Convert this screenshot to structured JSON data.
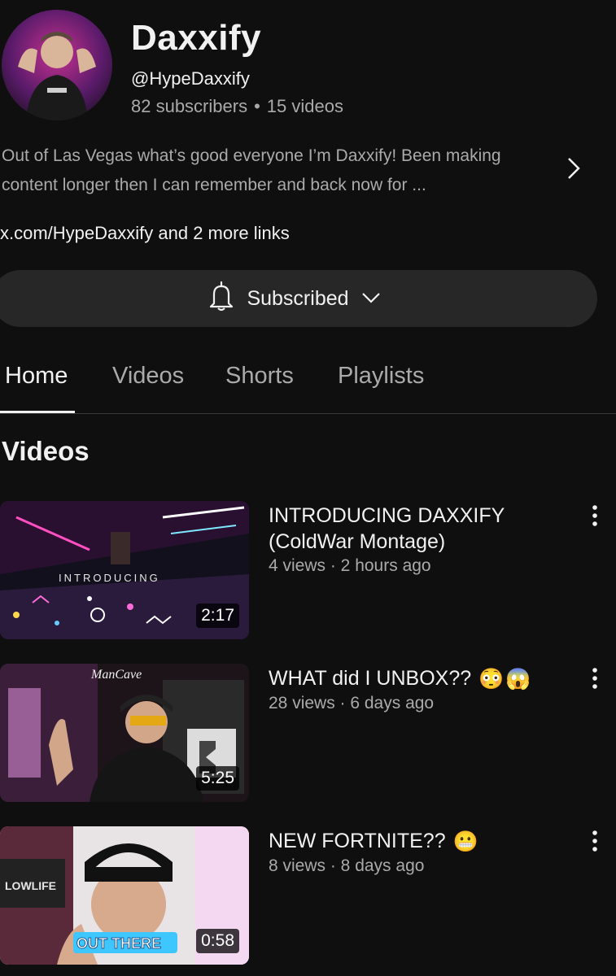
{
  "channel": {
    "name": "Daxxify",
    "handle": "@HypeDaxxify",
    "subscribers": "82 subscribers",
    "videos_count": "15 videos",
    "description": "Out of Las Vegas what’s good everyone I’m Daxxify! Been making content longer then I can remember and back now for ...",
    "links": "x.com/HypeDaxxify and 2 more links"
  },
  "subscribe_button": {
    "label": "Subscribed"
  },
  "tabs": [
    {
      "label": "Home",
      "active": true
    },
    {
      "label": "Videos",
      "active": false
    },
    {
      "label": "Shorts",
      "active": false
    },
    {
      "label": "Playlists",
      "active": false
    }
  ],
  "section": {
    "title": "Videos"
  },
  "videos": [
    {
      "title": "INTRODUCING DAXXIFY (ColdWar Montage)",
      "meta": "4 views · 2 hours ago",
      "duration": "2:17",
      "thumb_text": "INTRODUCING"
    },
    {
      "title": "WHAT did I UNBOX??",
      "meta": "28 views · 6 days ago",
      "duration": "5:25",
      "emojis": [
        "😳",
        "😱"
      ]
    },
    {
      "title": "NEW FORTNITE??",
      "meta": "8 views · 8 days ago",
      "duration": "0:58",
      "emojis": [
        "😬"
      ],
      "thumb_text": "OUT THERE"
    }
  ],
  "colors": {
    "background": "#0f0f0f",
    "text": "#f1f1f1",
    "secondary": "#aaaaaa",
    "button": "#272727"
  }
}
